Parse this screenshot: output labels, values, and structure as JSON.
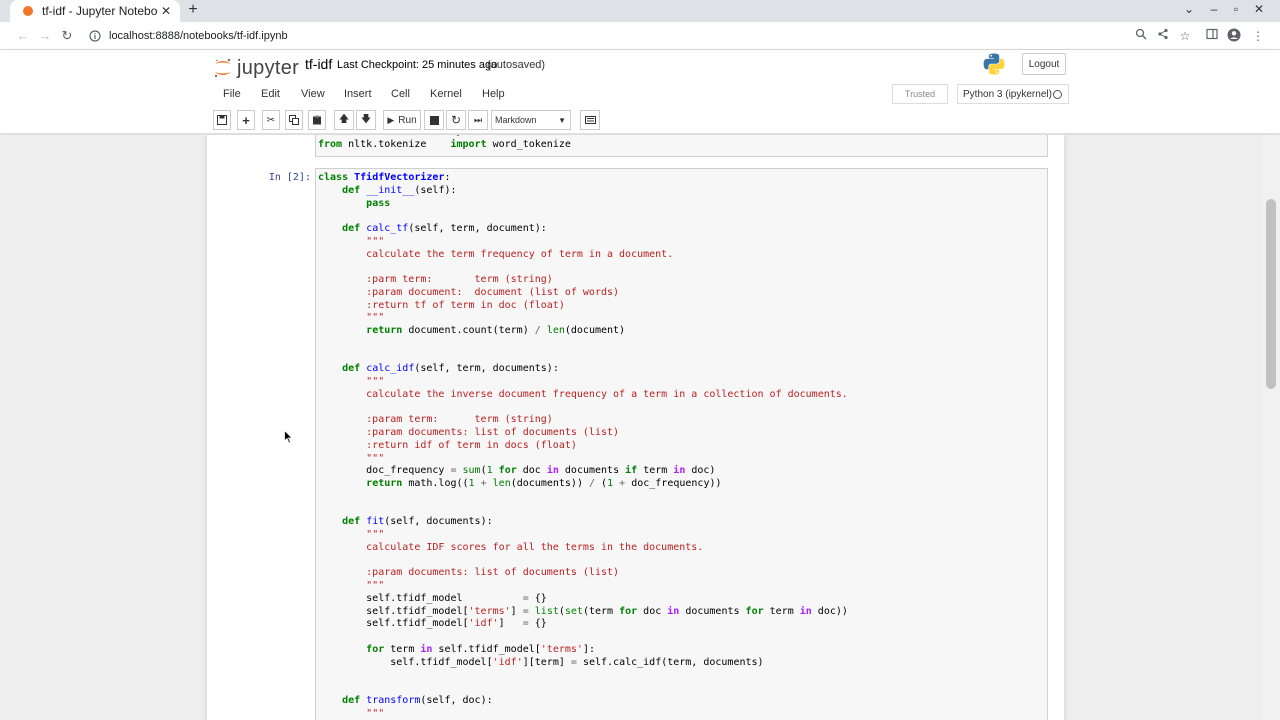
{
  "browser": {
    "tab_title": "tf-idf - Jupyter Notebook",
    "url": "localhost:8888/notebooks/tf-idf.ipynb"
  },
  "header": {
    "logo_text": "jupyter",
    "notebook_name": "tf-idf",
    "checkpoint": "Last Checkpoint: 25 minutes ago",
    "autosave": "(autosaved)",
    "logout_label": "Logout"
  },
  "menu": {
    "items": [
      "File",
      "Edit",
      "View",
      "Insert",
      "Cell",
      "Kernel",
      "Help"
    ],
    "trusted": "Trusted",
    "kernel": "Python 3 (ipykernel)"
  },
  "toolbar": {
    "run_label": "Run",
    "cell_type": "Markdown"
  },
  "cell": {
    "prompt": "In [2]:"
  },
  "colors": {
    "accent": "#f37726",
    "keyword": "#008000",
    "string": "#ba2121",
    "prompt": "#303f9f"
  }
}
